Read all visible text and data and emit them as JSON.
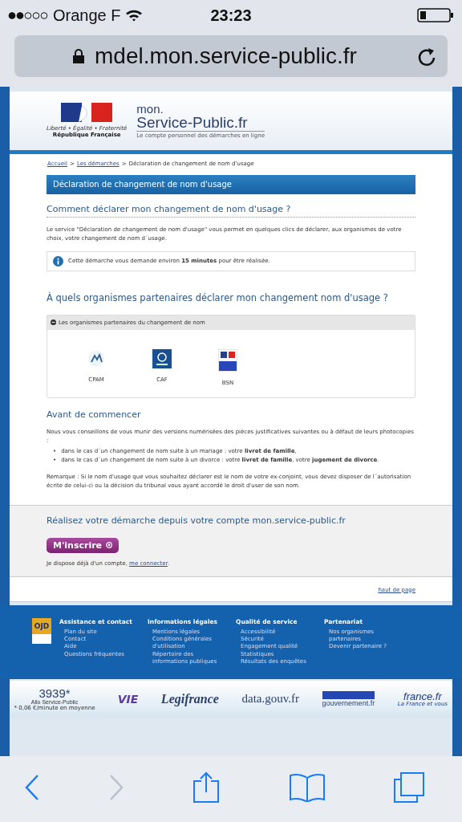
{
  "status_bar": {
    "carrier": "Orange F",
    "time": "23:23"
  },
  "address_bar": {
    "url": "mdel.mon.service-public.fr"
  },
  "header": {
    "motto": "Liberté • Égalité • Fraternité",
    "republic": "République Française",
    "brand_top": "mon.",
    "brand": "Service-Public.fr",
    "tagline": "Le compte personnel des démarches en ligne"
  },
  "breadcrumb": {
    "separator": ">",
    "items": [
      {
        "label": "Accueil",
        "link": true
      },
      {
        "label": "Les démarches",
        "link": true
      },
      {
        "label": "Déclaration de changement de nom d'usage",
        "link": false
      }
    ]
  },
  "page_title": "Déclaration de changement de nom d'usage",
  "how": {
    "heading": "Comment déclarer mon changement de nom d'usage ?",
    "text": "Le service \"Déclaration de changement de nom d'usage\" vous permet en quelques clics de déclarer, aux organismes de votre choix, votre changement de nom d´usage.",
    "info": "Cette démarche vous demande environ **15 minutes** pour être réalisée."
  },
  "partners": {
    "heading": "À quels organismes partenaires déclarer mon changement nom d'usage ?",
    "panel_title": "Les organismes partenaires du changement de nom",
    "items": [
      {
        "name": "CPAM",
        "kind": "cpam"
      },
      {
        "name": "CAF",
        "kind": "caf"
      },
      {
        "name": "BSN",
        "kind": "bsn"
      }
    ]
  },
  "before": {
    "heading": "Avant de commencer",
    "intro": "Nous vous conseillons de vous munir des versions numérisées des pièces justificatives suivantes ou à défaut de leurs photocopies :",
    "marker": "•",
    "bullets": [
      "dans le cas d´un changement de nom suite à un mariage : votre **livret de famille**,",
      "dans le cas d´un changement de nom suite à un divorce : votre **livret de famille**, votre **jugement de divorce**."
    ],
    "remark": "Remarque : Si le nom d'usage que vous souhaitez déclarer est le nom de votre ex-conjoint, vous devez disposer de l´autorisation écrite de celui-ci ou la décision du tribunal vous ayant accordé le droit d'user de son nom."
  },
  "signup": {
    "heading": "Réalisez votre démarche depuis votre compte mon.service-public.fr",
    "button": "M'inscrire",
    "account_text": "Je dispose déjà d'un compte, ",
    "account_link": "me connecter",
    "account_end": "."
  },
  "top_link": "haut de page",
  "footer": {
    "badge": "OJD",
    "columns": [
      {
        "heading": "Assistance et contact",
        "items": [
          "Plan du site",
          "Contact",
          "Aide",
          "Questions fréquentes"
        ]
      },
      {
        "heading": "Informations légales",
        "items": [
          "Mentions légales",
          "Conditions générales d'utilisation",
          "Répertoire des informations publiques"
        ]
      },
      {
        "heading": "Qualité de service",
        "items": [
          "Accessibilité",
          "Sécurité",
          "Engagement qualité",
          "Statistiques",
          "Résultats des enquêtes"
        ]
      },
      {
        "heading": "Partenariat",
        "items": [
          "Nos organismes partenaires",
          "Devenir partenaire ?"
        ]
      }
    ]
  },
  "logos": [
    {
      "kind": "allo",
      "lines": [
        "3939*",
        "Allo Service-Public",
        "* 0,06 €/minute en moyenne"
      ]
    },
    {
      "kind": "vie",
      "lines": [
        "VIE"
      ]
    },
    {
      "kind": "legifrance",
      "lines": [
        "Legifrance"
      ]
    },
    {
      "kind": "data",
      "lines": [
        "data.gouv.fr"
      ]
    },
    {
      "kind": "gouv",
      "lines": [
        "gouvernement.fr"
      ]
    },
    {
      "kind": "france",
      "lines": [
        "france.fr",
        "La France et vous"
      ]
    }
  ]
}
